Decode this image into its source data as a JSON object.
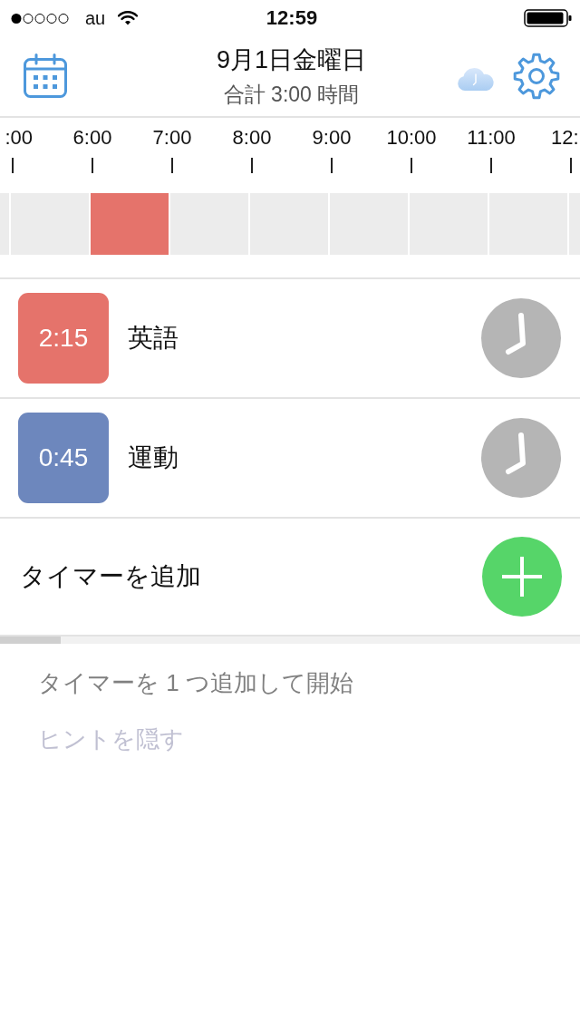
{
  "status_bar": {
    "carrier": "au",
    "time": "12:59"
  },
  "header": {
    "title": "9月1日金曜日",
    "subtitle": "合計 3:00 時間"
  },
  "timeline": {
    "hours": [
      {
        "label": ":00"
      },
      {
        "label": "6:00"
      },
      {
        "label": "7:00"
      },
      {
        "label": "8:00"
      },
      {
        "label": "9:00"
      },
      {
        "label": "10:00"
      },
      {
        "label": "11:00"
      },
      {
        "label": "12:"
      }
    ],
    "slots": [
      {
        "color": "#ececec"
      },
      {
        "color": "#ececec"
      },
      {
        "color": "#e5736b"
      },
      {
        "color": "#ececec"
      },
      {
        "color": "#ececec"
      },
      {
        "color": "#ececec"
      },
      {
        "color": "#ececec"
      },
      {
        "color": "#ececec"
      },
      {
        "color": "#ececec"
      }
    ]
  },
  "timers": [
    {
      "time": "2:15",
      "name": "英語",
      "color": "#e5736b"
    },
    {
      "time": "0:45",
      "name": "運動",
      "color": "#6d87bd"
    }
  ],
  "add_timer": {
    "label": "タイマーを追加"
  },
  "hint": {
    "text": "タイマーを 1 つ追加して開始",
    "hide_link": "ヒントを隠す"
  }
}
